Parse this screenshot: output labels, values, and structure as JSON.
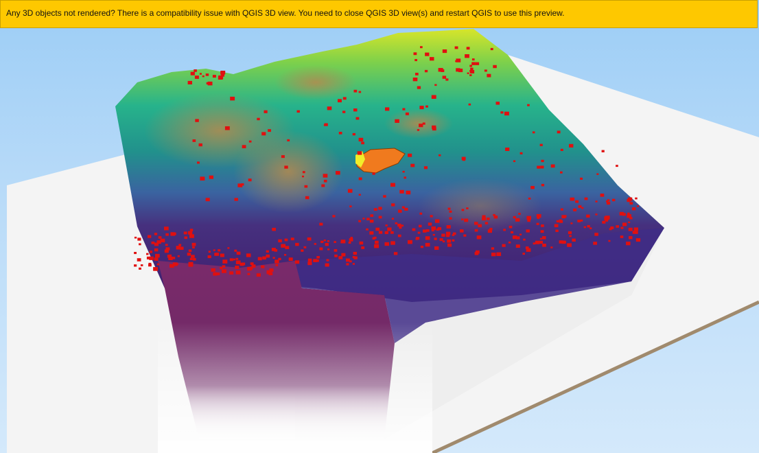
{
  "warning": {
    "message": "Any 3D objects not rendered? There is a compatibility issue with QGIS 3D view. You need to close QGIS 3D view(s) and restart QGIS to use this preview.",
    "background_color": "#fec800"
  },
  "scene": {
    "sky_color": "#a9d3f7",
    "ground_plane_color": "#f3f3f3",
    "ground_edge_color": "#a08a6d",
    "building_color": "#e01010",
    "terrain_colormap": "viridis",
    "highlight_polygon_color": "#f07a1e"
  }
}
